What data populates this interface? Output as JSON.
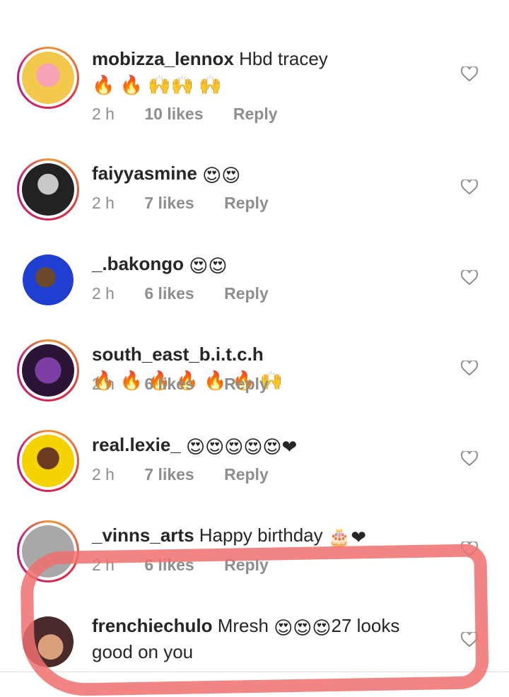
{
  "comments": [
    {
      "user": "mobizza_lennox",
      "text": "Hbd tracey",
      "emoji": "🔥 🔥 🙌🙌 🙌",
      "time": "2 h",
      "likes": "10 likes",
      "reply": "Reply"
    },
    {
      "user": "faiyyasmine",
      "text": "",
      "emoji": "😍😍",
      "time": "2 h",
      "likes": "7 likes",
      "reply": "Reply"
    },
    {
      "user": "_.bakongo",
      "text": "",
      "emoji": "😍😍",
      "time": "2 h",
      "likes": "6 likes",
      "reply": "Reply"
    },
    {
      "user": "south_east_b.i.t.c.h",
      "text": "",
      "emoji": "🔥 🔥 🔥 🔥 🔥 🔥 🙌",
      "time": "2 h",
      "likes": "6 likes",
      "reply": "Reply"
    },
    {
      "user": "real.lexie_",
      "text": "",
      "emoji": "😍😍😍😍😍❤",
      "time": "2 h",
      "likes": "7 likes",
      "reply": "Reply"
    },
    {
      "user": "_vinns_arts",
      "text": "Happy birthday",
      "emoji": "🎂❤",
      "time": "2 h",
      "likes": "6 likes",
      "reply": "Reply"
    },
    {
      "user": "frenchiechulo",
      "text": "Mresh",
      "emoji": "😍😍😍",
      "text2": "27 looks good on you"
    }
  ],
  "colors": {
    "text": "#262626",
    "meta": "#8e8e8e",
    "highlight": "#f06e6e"
  }
}
